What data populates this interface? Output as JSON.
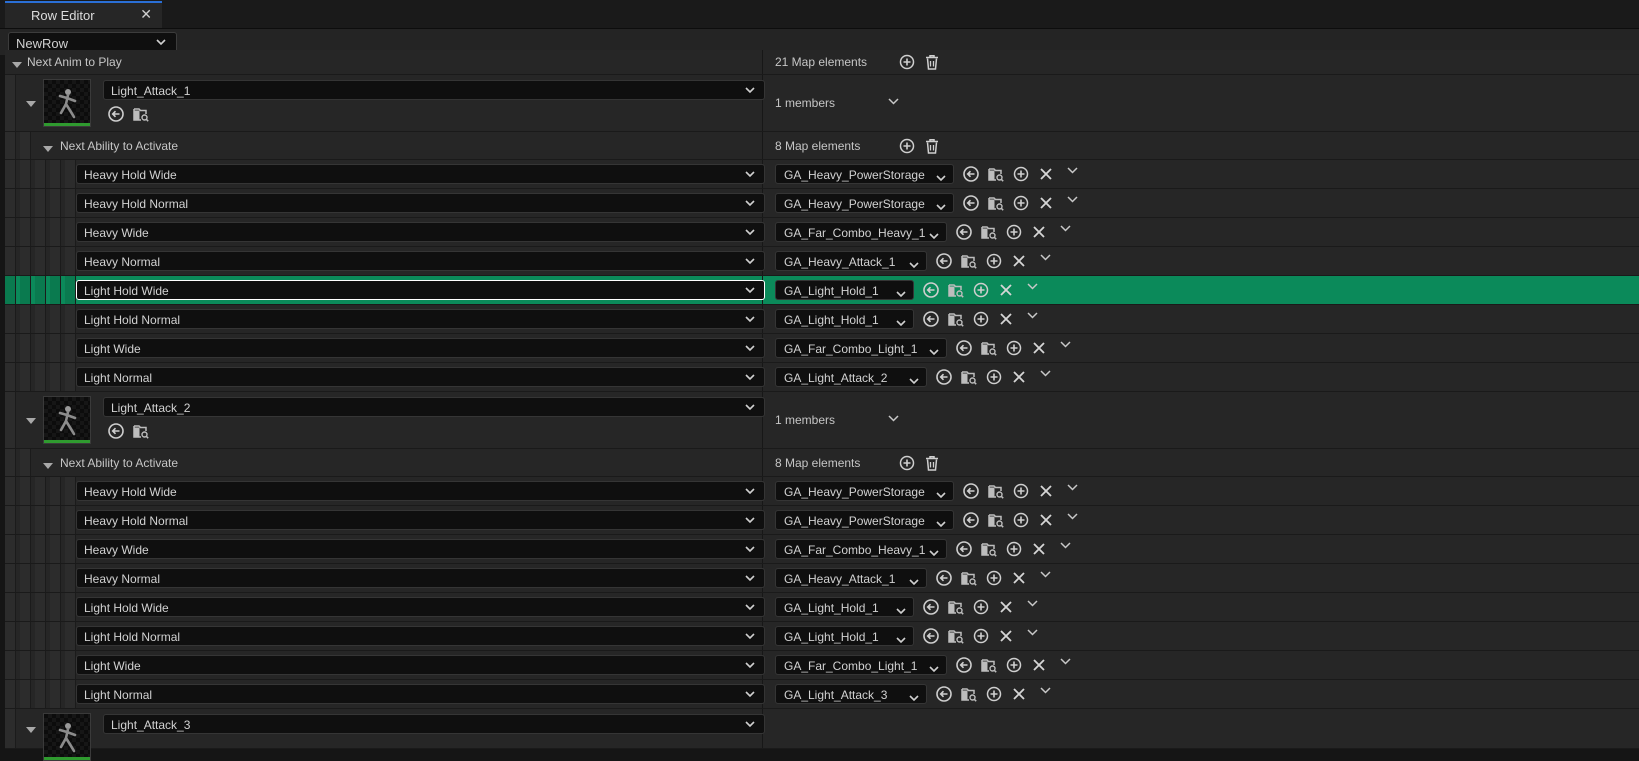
{
  "tab": {
    "title": "Row Editor",
    "close": "✕"
  },
  "row_selector": {
    "value": "NewRow"
  },
  "root": {
    "label": "Next Anim to Play",
    "count": "21 Map elements"
  },
  "groups": [
    {
      "name": "Light_Attack_1",
      "members": "1 members",
      "sub_label": "Next Ability to Activate",
      "sub_count": "8 Map elements",
      "entries": [
        {
          "key": "Heavy Hold Wide",
          "value": "GA_Heavy_PowerStorage"
        },
        {
          "key": "Heavy Hold Normal",
          "value": "GA_Heavy_PowerStorage"
        },
        {
          "key": "Heavy Wide",
          "value": "GA_Far_Combo_Heavy_1"
        },
        {
          "key": "Heavy Normal",
          "value": "GA_Heavy_Attack_1"
        },
        {
          "key": "Light Hold Wide",
          "value": "GA_Light_Hold_1"
        },
        {
          "key": "Light Hold Normal",
          "value": "GA_Light_Hold_1"
        },
        {
          "key": "Light Wide",
          "value": "GA_Far_Combo_Light_1"
        },
        {
          "key": "Light Normal",
          "value": "GA_Light_Attack_2"
        }
      ]
    },
    {
      "name": "Light_Attack_2",
      "members": "1 members",
      "sub_label": "Next Ability to Activate",
      "sub_count": "8 Map elements",
      "entries": [
        {
          "key": "Heavy Hold Wide",
          "value": "GA_Heavy_PowerStorage"
        },
        {
          "key": "Heavy Hold Normal",
          "value": "GA_Heavy_PowerStorage"
        },
        {
          "key": "Heavy Wide",
          "value": "GA_Far_Combo_Heavy_1"
        },
        {
          "key": "Heavy Normal",
          "value": "GA_Heavy_Attack_1"
        },
        {
          "key": "Light Hold Wide",
          "value": "GA_Light_Hold_1"
        },
        {
          "key": "Light Hold Normal",
          "value": "GA_Light_Hold_1"
        },
        {
          "key": "Light Wide",
          "value": "GA_Far_Combo_Light_1"
        },
        {
          "key": "Light Normal",
          "value": "GA_Light_Attack_3"
        }
      ]
    },
    {
      "name": "Light_Attack_3"
    }
  ],
  "selected_row": "Light Hold Wide",
  "icons": {
    "expand": "caret-down-icon",
    "browse": "use-selected-arrow-icon",
    "find": "browse-asset-folder-icon",
    "add": "add-element-plus-icon",
    "empty": "trash-empty-icon",
    "remove": "close-x-icon",
    "dropdown": "chevron-down-icon"
  },
  "colors": {
    "highlight": "#0b8a5a",
    "tab_accent": "#2a6fd6",
    "thumb_bar": "#2f9a2f"
  }
}
